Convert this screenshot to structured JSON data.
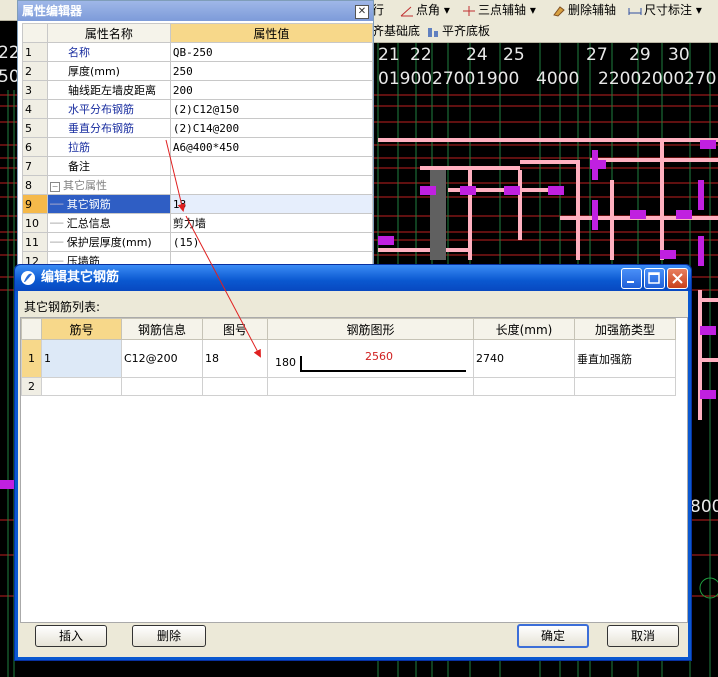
{
  "toolbar": {
    "items": [
      "行",
      "点角",
      "三点辅轴",
      "删除辅轴",
      "尺寸标注"
    ],
    "row2": [
      "齐基础底",
      "平齐底板"
    ]
  },
  "cad": {
    "axis_labels_top": [
      "22",
      "25",
      "21",
      "22",
      "24",
      "25",
      "27",
      "29",
      "30"
    ],
    "dimensions": [
      "01900",
      "2700",
      "1900",
      "4000",
      "2200",
      "2000",
      "270"
    ],
    "left_fragments": [
      "50",
      "22"
    ],
    "right_fragment": "800"
  },
  "prop_editor": {
    "title": "属性编辑器",
    "col_name": "属性名称",
    "col_value": "属性值",
    "rows": [
      {
        "num": "1",
        "name": "名称",
        "value": "QB-250"
      },
      {
        "num": "2",
        "name": "厚度(mm)",
        "value": "250"
      },
      {
        "num": "3",
        "name": "轴线距左墙皮距离",
        "value": "200"
      },
      {
        "num": "4",
        "name": "水平分布钢筋",
        "value": "(2)C12@150"
      },
      {
        "num": "5",
        "name": "垂直分布钢筋",
        "value": "(2)C14@200"
      },
      {
        "num": "6",
        "name": "拉筋",
        "value": "A6@400*450"
      },
      {
        "num": "7",
        "name": "备注",
        "value": ""
      },
      {
        "num": "8",
        "name": "其它属性",
        "value": ""
      },
      {
        "num": "9",
        "name": "其它钢筋",
        "value": "18"
      },
      {
        "num": "10",
        "name": "汇总信息",
        "value": "剪力墙"
      },
      {
        "num": "11",
        "name": "保护层厚度(mm)",
        "value": "(15)"
      },
      {
        "num": "12",
        "name": "压墙筋",
        "value": ""
      }
    ]
  },
  "dialog": {
    "title": "编辑其它钢筋",
    "list_label": "其它钢筋列表:",
    "columns": [
      "筋号",
      "钢筋信息",
      "图号",
      "钢筋图形",
      "长度(mm)",
      "加强筋类型"
    ],
    "rows": [
      {
        "num": "1",
        "cells": [
          "1",
          "C12@200",
          "18",
          "",
          "2740",
          "垂直加强筋"
        ],
        "shape_left": "180",
        "shape_top": "2560"
      },
      {
        "num": "2",
        "cells": [
          "",
          "",
          "",
          "",
          "",
          ""
        ],
        "shape_left": "",
        "shape_top": ""
      }
    ],
    "buttons": {
      "insert": "插入",
      "delete": "删除",
      "ok": "确定",
      "cancel": "取消"
    }
  }
}
